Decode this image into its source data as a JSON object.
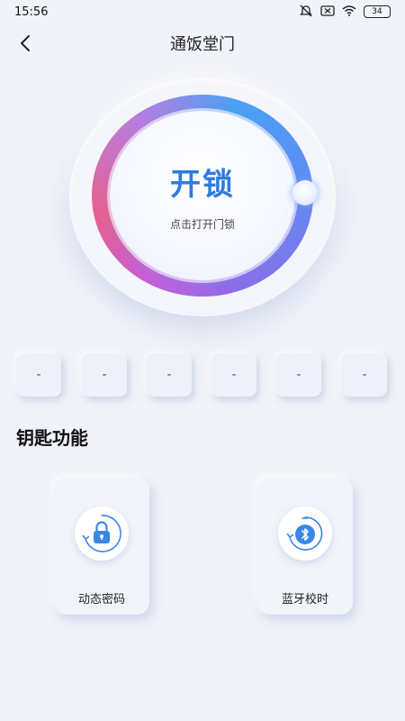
{
  "status_bar": {
    "time": "15:56",
    "battery": "34"
  },
  "nav": {
    "title": "通饭堂门"
  },
  "unlock": {
    "label": "开锁",
    "hint": "点击打开门锁"
  },
  "digits": [
    "-",
    "-",
    "-",
    "-",
    "-",
    "-"
  ],
  "section": {
    "title": "钥匙功能"
  },
  "functions": [
    {
      "label": "动态密码",
      "icon": "lock-icon"
    },
    {
      "label": "蓝牙校时",
      "icon": "bluetooth-sync-icon"
    }
  ],
  "colors": {
    "accent": "#2f7be0",
    "icon_blue": "#3a86e8",
    "background": "#f1f3fa"
  }
}
